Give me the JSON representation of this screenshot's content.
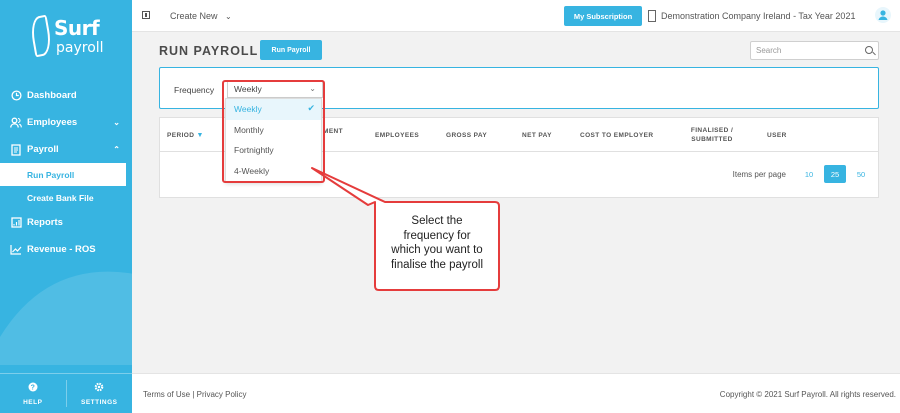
{
  "brand": {
    "line1": "Surf",
    "line2": "payroll"
  },
  "sidebar": {
    "items": [
      {
        "label": "Dashboard",
        "icon": "clock-icon"
      },
      {
        "label": "Employees",
        "icon": "people-icon"
      },
      {
        "label": "Payroll",
        "icon": "document-icon"
      },
      {
        "label": "Reports",
        "icon": "report-icon"
      },
      {
        "label": "Revenue - ROS",
        "icon": "chart-icon"
      }
    ],
    "payroll_sub": [
      "Run Payroll",
      "Create Bank File"
    ],
    "bottom": {
      "help": "HELP",
      "settings": "SETTINGS"
    }
  },
  "topbar": {
    "create_new": "Create New",
    "subscription": "My Subscription",
    "company": "Demonstration Company Ireland - Tax Year 2021"
  },
  "page": {
    "title": "RUN PAYROLL",
    "run_button": "Run Payroll",
    "search_placeholder": "Search"
  },
  "frequency": {
    "label": "Frequency",
    "selected": "Weekly",
    "options": [
      "Weekly",
      "Monthly",
      "Fortnightly",
      "4-Weekly"
    ]
  },
  "table": {
    "columns": {
      "period": "PERIOD",
      "payment": "MENT",
      "employees": "EMPLOYEES",
      "gross_pay": "GROSS PAY",
      "net_pay": "NET PAY",
      "cost": "COST TO EMPLOYER",
      "finalised_1": "FINALISED /",
      "finalised_2": "SUBMITTED",
      "user": "USER"
    },
    "pager": {
      "label": "Items per page",
      "options": [
        "10",
        "25",
        "50"
      ],
      "active": "25"
    }
  },
  "callout": {
    "line1": "Select the",
    "line2": "frequency for",
    "line3": "which you want to",
    "line4": "finalise the payroll"
  },
  "footer": {
    "terms": "Terms of Use",
    "sep": "|",
    "privacy": "Privacy Policy",
    "copyright": "Copyright © 2021 Surf Payroll. All rights reserved."
  },
  "colors": {
    "brand": "#37b4e1",
    "callout": "#e53c3c"
  }
}
